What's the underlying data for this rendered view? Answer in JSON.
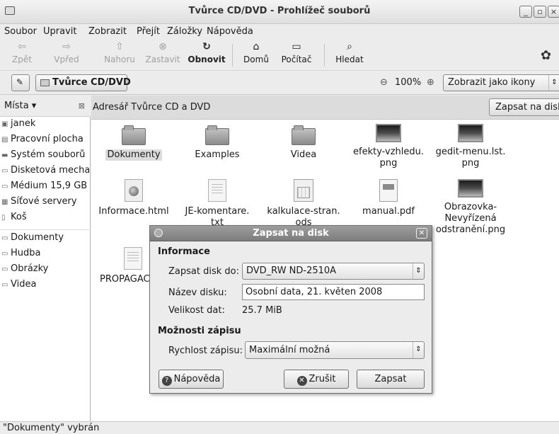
{
  "window": {
    "title": "Tvůrce CD/DVD - Prohlížeč souborů",
    "buttons": [
      "_",
      "▫",
      "×"
    ]
  },
  "menubar": {
    "items": [
      "Soubor",
      "Upravit",
      "Zobrazit",
      "Přejít",
      "Záložky",
      "Nápověda"
    ]
  },
  "toolbar": {
    "back": "Zpět",
    "forward": "Vpřed",
    "up": "Nahoru",
    "stop": "Zastavit",
    "reload": "Obnovit",
    "home": "Domů",
    "computer": "Počítač",
    "search": "Hledat"
  },
  "location": {
    "path_button": "Tvůrce CD/DVD",
    "zoom": "100%",
    "view_mode": "Zobrazit jako ikony"
  },
  "sidebar": {
    "header": "Místa",
    "items": [
      "janek",
      "Pracovní plocha",
      "Systém souborů",
      "Disketová mechanika",
      "Médium 15,9 GB",
      "Síťové servery",
      "Koš",
      "Dokumenty",
      "Hudba",
      "Obrázky",
      "Videa"
    ]
  },
  "content": {
    "header": "Adresář Tvůrce CD a DVD",
    "burn_button": "Zapsat na disk",
    "files": [
      {
        "name": "Dokumenty",
        "type": "folder",
        "selected": true
      },
      {
        "name": "Examples",
        "type": "folder"
      },
      {
        "name": "Videa",
        "type": "folder"
      },
      {
        "name": "efekty-vzhledu.\npng",
        "type": "image"
      },
      {
        "name": "gedit-menu.lst.\npng",
        "type": "image"
      },
      {
        "name": "Informace.html",
        "type": "html"
      },
      {
        "name": "JE-komentare.\ntxt",
        "type": "text"
      },
      {
        "name": "kalkulace-stran.\nods",
        "type": "spreadsheet"
      },
      {
        "name": "manual.pdf",
        "type": "pdf"
      },
      {
        "name": "Obrazovka-\nNevyřízená\nodstranění.png",
        "type": "image"
      },
      {
        "name": "PROPAGAC",
        "type": "text"
      }
    ]
  },
  "statusbar": {
    "text": "\"Dokumenty\" vybrán"
  },
  "dialog": {
    "title": "Zapsat na disk",
    "section_info": "Informace",
    "burn_to_label": "Zapsat disk do:",
    "burn_to_value": "DVD_RW ND-2510A",
    "disc_name_label": "Název disku:",
    "disc_name_value": "Osobní data, 21. květen 2008",
    "data_size_label": "Velikost dat:",
    "data_size_value": "25.7 MiB",
    "section_options": "Možnosti zápisu",
    "speed_label": "Rychlost zápisu:",
    "speed_value": "Maximální možná",
    "help_button": "Nápověda",
    "cancel_button": "Zrušit",
    "burn_button": "Zapsat"
  }
}
